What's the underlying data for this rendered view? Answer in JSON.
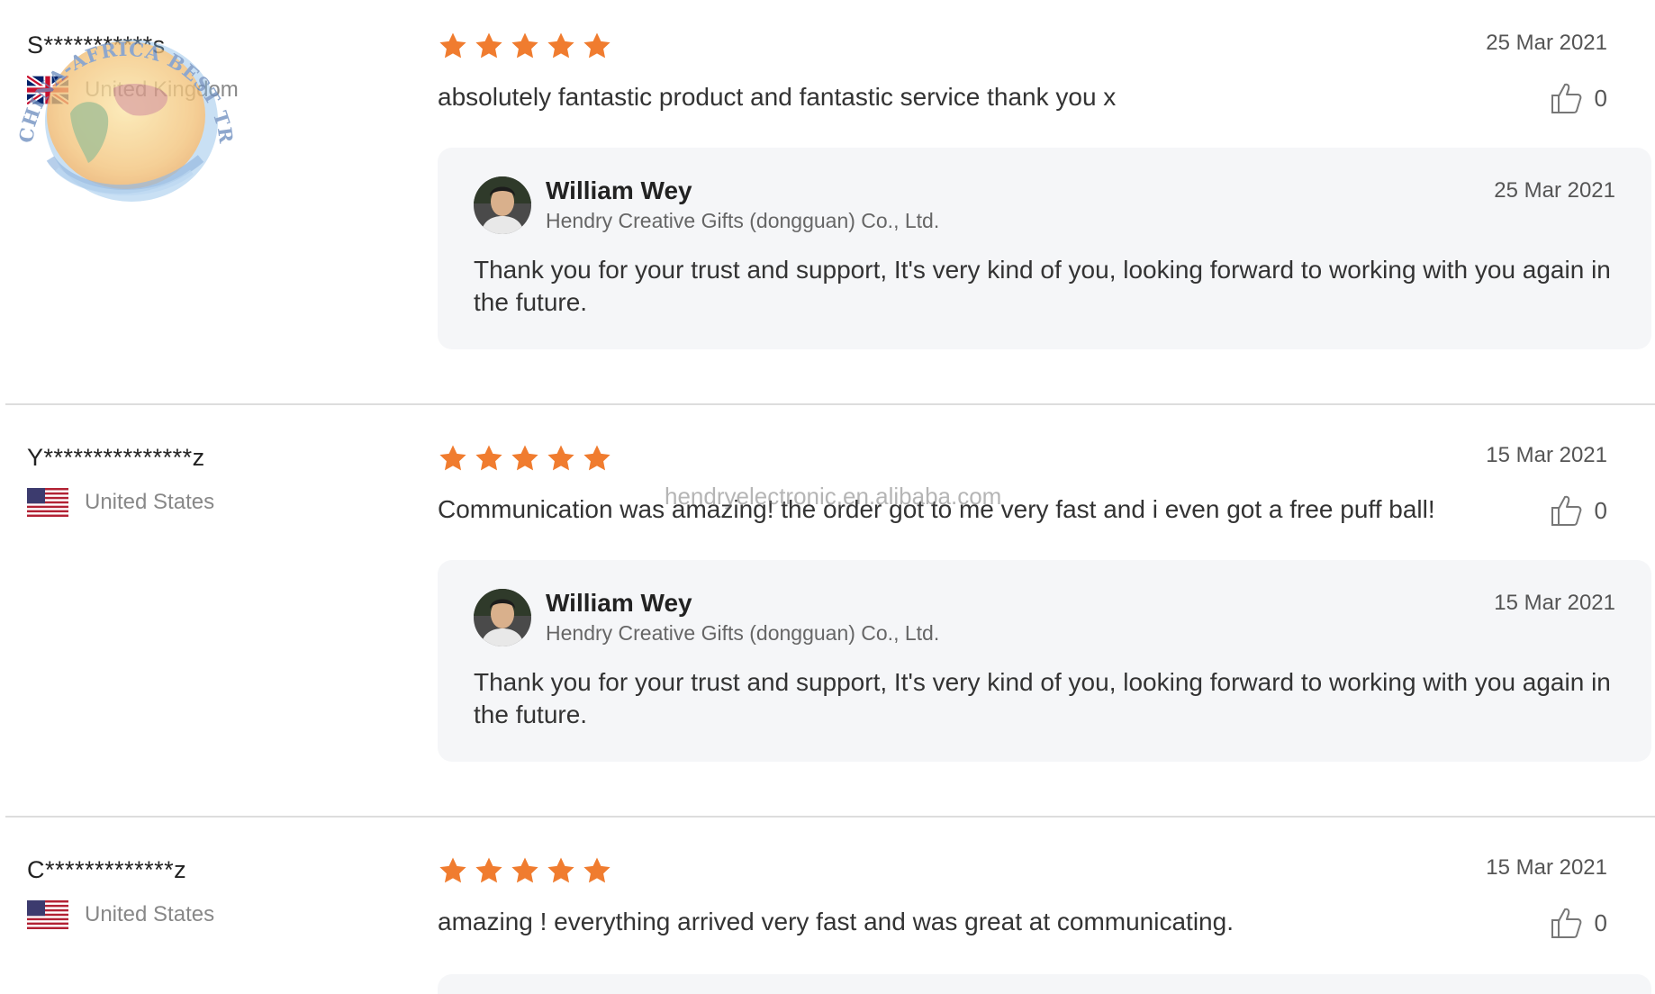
{
  "reviews": [
    {
      "buyer_name": "S***********s",
      "country": "United Kingdom",
      "flag": "uk-flag-icon",
      "rating": 5,
      "date": "25 Mar 2021",
      "text": "absolutely fantastic product and fantastic service thank you x",
      "likes": "0",
      "reply": {
        "name": "William Wey",
        "company": "Hendry Creative Gifts (dongguan) Co., Ltd.",
        "date": "25 Mar 2021",
        "text": "Thank you for your trust and support, It's very kind of you, looking forward to working with you again in the future."
      }
    },
    {
      "buyer_name": "Y***************z",
      "country": "United States",
      "flag": "us-flag-icon",
      "rating": 5,
      "date": "15 Mar 2021",
      "text": "Communication was amazing! the order got to me very fast and i even got a free puff ball!",
      "likes": "0",
      "reply": {
        "name": "William Wey",
        "company": "Hendry Creative Gifts (dongguan) Co., Ltd.",
        "date": "15 Mar 2021",
        "text": "Thank you for your trust and support, It's very kind of you, looking forward to working with you again in the future."
      }
    },
    {
      "buyer_name": "C*************z",
      "country": "United States",
      "flag": "us-flag-icon",
      "rating": 5,
      "date": "15 Mar 2021",
      "text": "amazing ! everything arrived very fast and was great at communicating.",
      "likes": "0"
    }
  ],
  "watermark": {
    "url": "hendryelectronic.en.alibaba.com",
    "seal_text": "CHINA-AFRICA BEST TRADING PLATFORM"
  },
  "colors": {
    "star": "#f07c2f",
    "reply_bg": "#f5f6f8",
    "divider": "#dddddd"
  }
}
